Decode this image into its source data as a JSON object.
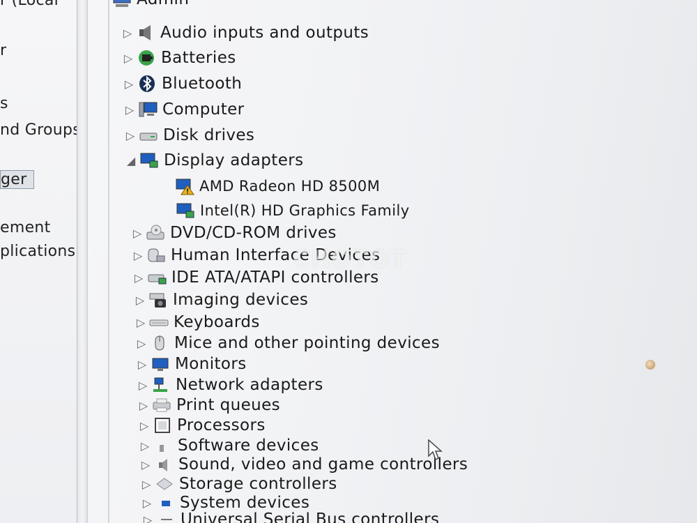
{
  "left_pane": {
    "items": [
      {
        "text": "r (Local"
      },
      {
        "text": "r"
      },
      {
        "text": "s"
      },
      {
        "text": "nd Groups"
      },
      {
        "text": "ger"
      },
      {
        "text": "ement"
      },
      {
        "text": "plications"
      }
    ]
  },
  "tree": {
    "root": {
      "label": "Admin"
    },
    "categories": [
      {
        "label": "Audio inputs and outputs",
        "icon": "speaker-icon",
        "expanded": false
      },
      {
        "label": "Batteries",
        "icon": "battery-icon",
        "expanded": false
      },
      {
        "label": "Bluetooth",
        "icon": "bluetooth-icon",
        "expanded": false
      },
      {
        "label": "Computer",
        "icon": "computer-icon",
        "expanded": false
      },
      {
        "label": "Disk drives",
        "icon": "disk-drive-icon",
        "expanded": false
      },
      {
        "label": "Display adapters",
        "icon": "display-adapter-icon",
        "expanded": true,
        "children": [
          {
            "label": "AMD Radeon HD 8500M",
            "icon": "display-adapter-warning-icon"
          },
          {
            "label": "Intel(R) HD Graphics Family",
            "icon": "display-adapter-icon"
          }
        ]
      },
      {
        "label": "DVD/CD-ROM drives",
        "icon": "dvd-drive-icon",
        "expanded": false
      },
      {
        "label": "Human Interface Devices",
        "icon": "hid-icon",
        "expanded": false
      },
      {
        "label": "IDE ATA/ATAPI controllers",
        "icon": "ide-controller-icon",
        "expanded": false
      },
      {
        "label": "Imaging devices",
        "icon": "camera-icon",
        "expanded": false
      },
      {
        "label": "Keyboards",
        "icon": "keyboard-icon",
        "expanded": false
      },
      {
        "label": "Mice and other pointing devices",
        "icon": "mouse-icon",
        "expanded": false
      },
      {
        "label": "Monitors",
        "icon": "monitor-icon",
        "expanded": false
      },
      {
        "label": "Network adapters",
        "icon": "network-icon",
        "expanded": false
      },
      {
        "label": "Print queues",
        "icon": "printer-icon",
        "expanded": false
      },
      {
        "label": "Processors",
        "icon": "processor-icon",
        "expanded": false
      },
      {
        "label": "Software devices",
        "icon": "software-device-icon",
        "expanded": false
      },
      {
        "label": "Sound, video and game controllers",
        "icon": "sound-icon",
        "expanded": false
      },
      {
        "label": "Storage controllers",
        "icon": "storage-controller-icon",
        "expanded": false
      },
      {
        "label": "System devices",
        "icon": "system-device-icon",
        "expanded": false
      },
      {
        "label": "Universal Serial Bus controllers",
        "icon": "usb-icon",
        "expanded": false
      }
    ]
  },
  "watermark": {
    "text": "CHOTOT"
  },
  "colors": {
    "warning": "#e8b320",
    "icon_blue": "#1f5fbf",
    "text": "#1a1a1a"
  }
}
